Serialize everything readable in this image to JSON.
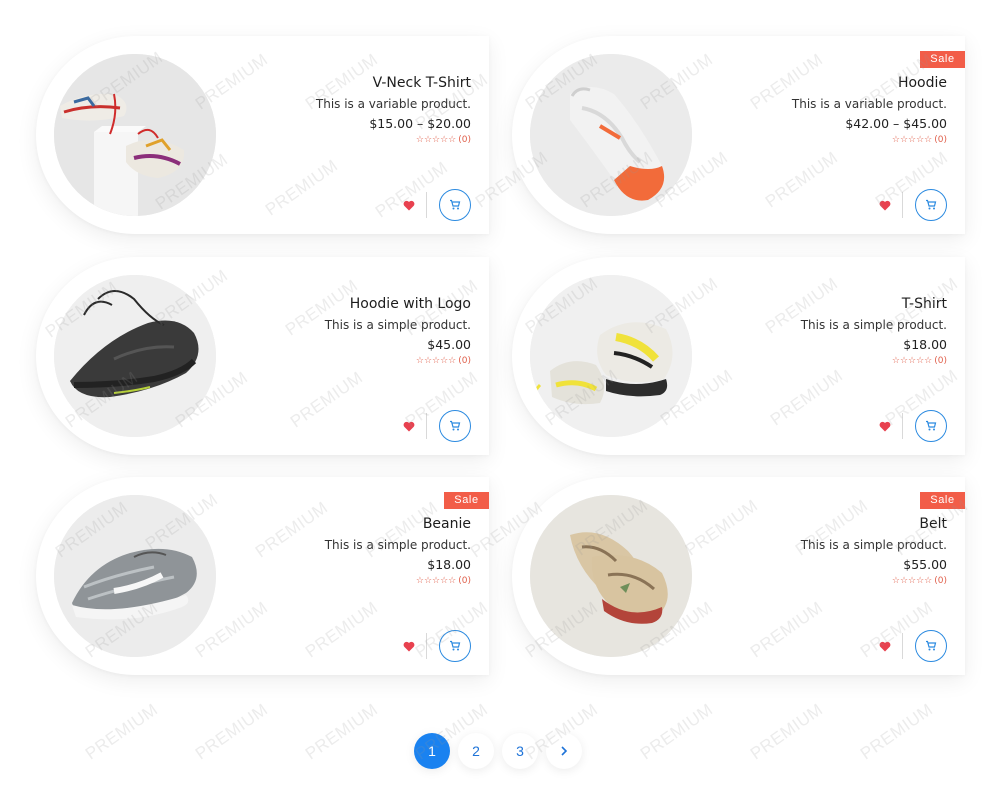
{
  "colors": {
    "accent": "#1a82f0",
    "sale": "#f25d48",
    "heart": "#e8414f",
    "star": "#e0604c"
  },
  "products": [
    {
      "title": "V-Neck T-Shirt",
      "description": "This is a variable product.",
      "price": "$15.00 – $20.00",
      "rating_count": "(0)",
      "sale": false,
      "image": "sneakers-on-box"
    },
    {
      "title": "Hoodie",
      "description": "This is a variable product.",
      "price": "$42.00 – $45.00",
      "rating_count": "(0)",
      "sale": true,
      "sale_label": "Sale",
      "image": "orange-running-shoe"
    },
    {
      "title": "Hoodie with Logo",
      "description": "This is a simple product.",
      "price": "$45.00",
      "rating_count": "(0)",
      "sale": false,
      "image": "black-flying-sneaker"
    },
    {
      "title": "T-Shirt",
      "description": "This is a simple product.",
      "price": "$18.00",
      "rating_count": "(0)",
      "sale": false,
      "image": "yellow-nike-pair"
    },
    {
      "title": "Beanie",
      "description": "This is a simple product.",
      "price": "$18.00",
      "rating_count": "(0)",
      "sale": true,
      "sale_label": "Sale",
      "image": "grey-knit-sneaker"
    },
    {
      "title": "Belt",
      "description": "This is a simple product.",
      "price": "$55.00",
      "rating_count": "(0)",
      "sale": true,
      "sale_label": "Sale",
      "image": "tan-pair-sneakers"
    }
  ],
  "rating_stars": "☆☆☆☆☆",
  "pagination": {
    "pages": [
      "1",
      "2",
      "3"
    ],
    "current": "1",
    "next_icon": "chevron-right-icon"
  },
  "watermark_text": "PREMIUM"
}
